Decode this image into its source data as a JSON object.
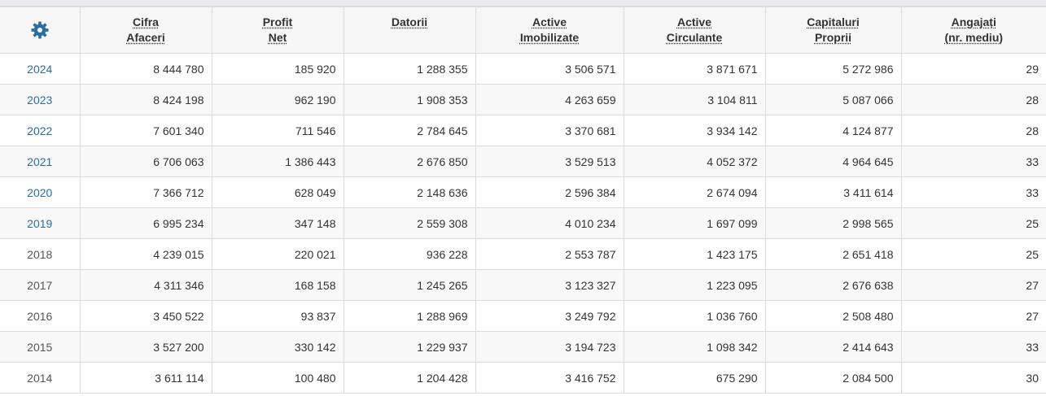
{
  "colors": {
    "link": "#2b6da3",
    "gear": "#2b6da3"
  },
  "header": {
    "settings_icon": "gear-icon",
    "columns": [
      {
        "line1": "Cifra",
        "line2": "Afaceri"
      },
      {
        "line1": "Profit",
        "line2": "Net"
      },
      {
        "line1": "Datorii",
        "line2": ""
      },
      {
        "line1": "Active",
        "line2": "Imobilizate"
      },
      {
        "line1": "Active",
        "line2": "Circulante"
      },
      {
        "line1": "Capitaluri",
        "line2": "Proprii"
      },
      {
        "line1": "Angajați",
        "line2": "(nr. mediu)"
      }
    ]
  },
  "rows": [
    {
      "year": "2024",
      "link": true,
      "values": [
        "8 444 780",
        "185 920",
        "1 288 355",
        "3 506 571",
        "3 871 671",
        "5 272 986",
        "29"
      ]
    },
    {
      "year": "2023",
      "link": true,
      "values": [
        "8 424 198",
        "962 190",
        "1 908 353",
        "4 263 659",
        "3 104 811",
        "5 087 066",
        "28"
      ]
    },
    {
      "year": "2022",
      "link": true,
      "values": [
        "7 601 340",
        "711 546",
        "2 784 645",
        "3 370 681",
        "3 934 142",
        "4 124 877",
        "28"
      ]
    },
    {
      "year": "2021",
      "link": true,
      "values": [
        "6 706 063",
        "1 386 443",
        "2 676 850",
        "3 529 513",
        "4 052 372",
        "4 964 645",
        "33"
      ]
    },
    {
      "year": "2020",
      "link": true,
      "values": [
        "7 366 712",
        "628 049",
        "2 148 636",
        "2 596 384",
        "2 674 094",
        "3 411 614",
        "33"
      ]
    },
    {
      "year": "2019",
      "link": true,
      "values": [
        "6 995 234",
        "347 148",
        "2 559 308",
        "4 010 234",
        "1 697 099",
        "2 998 565",
        "25"
      ]
    },
    {
      "year": "2018",
      "link": false,
      "values": [
        "4 239 015",
        "220 021",
        "936 228",
        "2 553 787",
        "1 423 175",
        "2 651 418",
        "25"
      ]
    },
    {
      "year": "2017",
      "link": false,
      "values": [
        "4 311 346",
        "168 158",
        "1 245 265",
        "3 123 327",
        "1 223 095",
        "2 676 638",
        "27"
      ]
    },
    {
      "year": "2016",
      "link": false,
      "values": [
        "3 450 522",
        "93 837",
        "1 288 969",
        "3 249 792",
        "1 036 760",
        "2 508 480",
        "27"
      ]
    },
    {
      "year": "2015",
      "link": false,
      "values": [
        "3 527 200",
        "330 142",
        "1 229 937",
        "3 194 723",
        "1 098 342",
        "2 414 643",
        "33"
      ]
    },
    {
      "year": "2014",
      "link": false,
      "values": [
        "3 611 114",
        "100 480",
        "1 204 428",
        "3 416 752",
        "675 290",
        "2 084 500",
        "30"
      ]
    }
  ]
}
